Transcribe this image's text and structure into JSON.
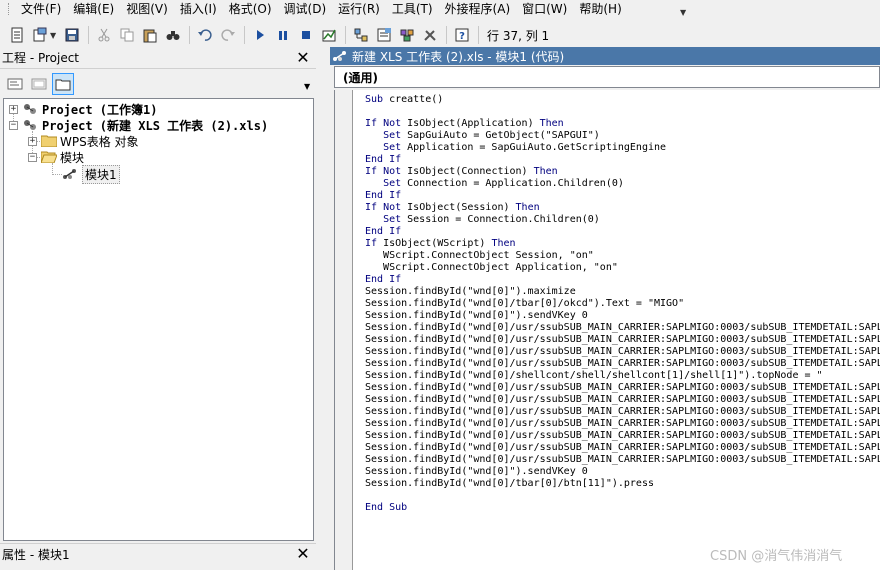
{
  "menubar": {
    "items": [
      "文件(F)",
      "编辑(E)",
      "视图(V)",
      "插入(I)",
      "格式(O)",
      "调试(D)",
      "运行(R)",
      "工具(T)",
      "外接程序(A)",
      "窗口(W)",
      "帮助(H)"
    ]
  },
  "toolbar": {
    "position": "行 37, 列 1"
  },
  "project_panel": {
    "title": "工程 - Project",
    "close": "✕",
    "tree": {
      "project1": "Project (工作簿1)",
      "project2": "Project (新建 XLS 工作表 (2).xls)",
      "wps_objects": "WPS表格 对象",
      "modules_folder": "模块",
      "module1": "模块1",
      "plus": "+",
      "minus": "−"
    }
  },
  "properties_panel": {
    "title": "属性 - 模块1",
    "close": "✕"
  },
  "code_window": {
    "title": "新建 XLS 工作表 (2).xls - 模块1 (代码)",
    "combo": "(通用)",
    "lines": [
      "Sub creatte()",
      "",
      "If Not IsObject(Application) Then",
      "   Set SapGuiAuto = GetObject(\"SAPGUI\")",
      "   Set Application = SapGuiAuto.GetScriptingEngine",
      "End If",
      "If Not IsObject(Connection) Then",
      "   Set Connection = Application.Children(0)",
      "End If",
      "If Not IsObject(Session) Then",
      "   Set Session = Connection.Children(0)",
      "End If",
      "If IsObject(WScript) Then",
      "   WScript.ConnectObject Session, \"on\"",
      "   WScript.ConnectObject Application, \"on\"",
      "End If",
      "Session.findById(\"wnd[0]\").maximize",
      "Session.findById(\"wnd[0]/tbar[0]/okcd\").Text = \"MIGO\"",
      "Session.findById(\"wnd[0]\").sendVKey 0",
      "Session.findById(\"wnd[0]/usr/ssubSUB_MAIN_CARRIER:SAPLMIGO:0003/subSUB_ITEMDETAIL:SAPL",
      "Session.findById(\"wnd[0]/usr/ssubSUB_MAIN_CARRIER:SAPLMIGO:0003/subSUB_ITEMDETAIL:SAPL",
      "Session.findById(\"wnd[0]/usr/ssubSUB_MAIN_CARRIER:SAPLMIGO:0003/subSUB_ITEMDETAIL:SAPL",
      "Session.findById(\"wnd[0]/usr/ssubSUB_MAIN_CARRIER:SAPLMIGO:0003/subSUB_ITEMDETAIL:SAPL",
      "Session.findById(\"wnd[0]/shellcont/shell/shellcont[1]/shell[1]\").topNode = \"",
      "Session.findById(\"wnd[0]/usr/ssubSUB_MAIN_CARRIER:SAPLMIGO:0003/subSUB_ITEMDETAIL:SAPL",
      "Session.findById(\"wnd[0]/usr/ssubSUB_MAIN_CARRIER:SAPLMIGO:0003/subSUB_ITEMDETAIL:SAPL",
      "Session.findById(\"wnd[0]/usr/ssubSUB_MAIN_CARRIER:SAPLMIGO:0003/subSUB_ITEMDETAIL:SAPL",
      "Session.findById(\"wnd[0]/usr/ssubSUB_MAIN_CARRIER:SAPLMIGO:0003/subSUB_ITEMDETAIL:SAPL",
      "Session.findById(\"wnd[0]/usr/ssubSUB_MAIN_CARRIER:SAPLMIGO:0003/subSUB_ITEMDETAIL:SAPL",
      "Session.findById(\"wnd[0]/usr/ssubSUB_MAIN_CARRIER:SAPLMIGO:0003/subSUB_ITEMDETAIL:SAPL",
      "Session.findById(\"wnd[0]/usr/ssubSUB_MAIN_CARRIER:SAPLMIGO:0003/subSUB_ITEMDETAIL:SAPL",
      "Session.findById(\"wnd[0]\").sendVKey 0",
      "Session.findById(\"wnd[0]/tbar[0]/btn[11]\").press",
      "",
      "End Sub"
    ]
  },
  "watermark": "CSDN @消气伟消消气",
  "colors": {
    "title_bar": "#4a77a8",
    "keyword": "#00007f"
  }
}
